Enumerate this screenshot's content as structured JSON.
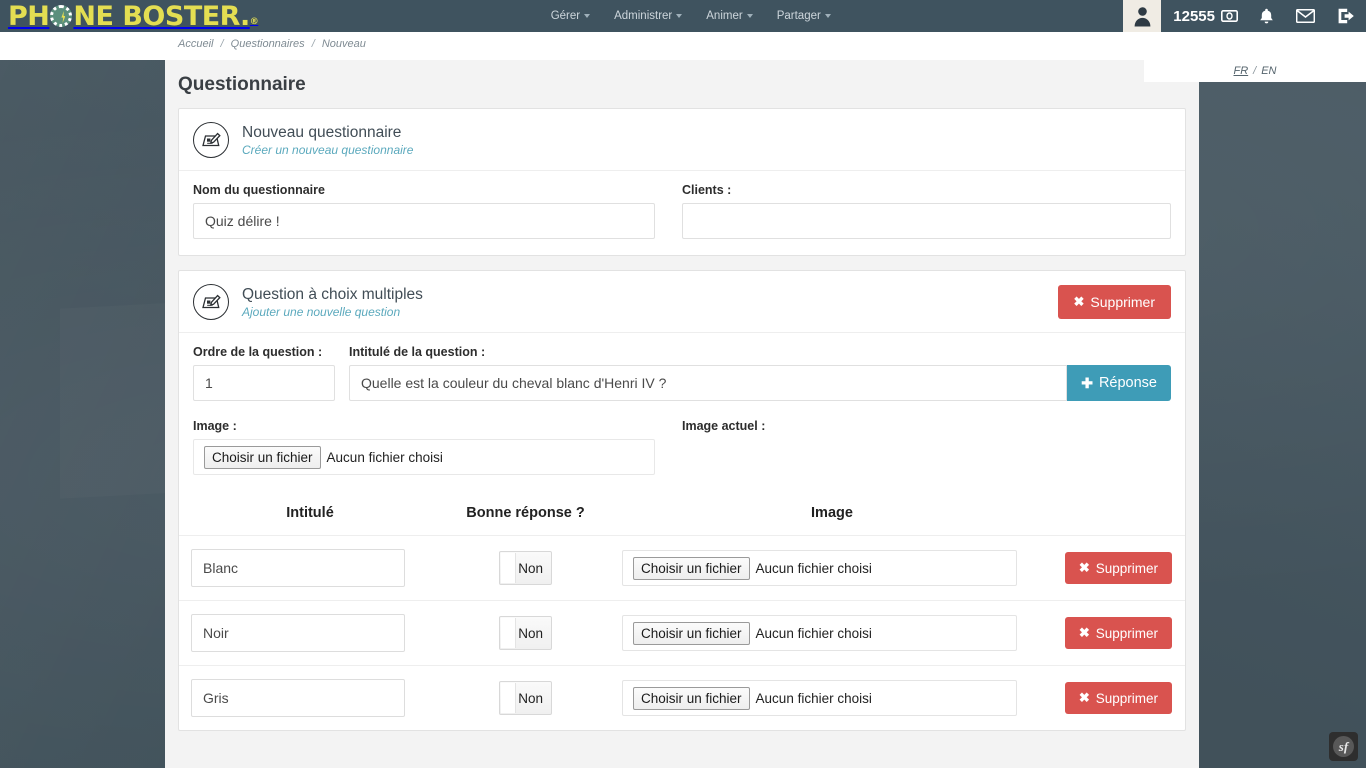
{
  "topbar": {
    "logo": {
      "part1": "PH",
      "o_icon": "phone-circle-icon",
      "part2": "NE B",
      "o2_icon": "letter-o",
      "part3": "OSTER",
      "dot": ".",
      "reg": "®"
    },
    "nav": [
      {
        "label": "Gérer",
        "icon": "chevron-down-icon"
      },
      {
        "label": "Administrer",
        "icon": "chevron-down-icon"
      },
      {
        "label": "Animer",
        "icon": "chevron-down-icon"
      },
      {
        "label": "Partager",
        "icon": "chevron-down-icon"
      }
    ],
    "avatar_icon": "user-avatar-icon",
    "credits": "12555",
    "credits_icon": "money-bill-icon",
    "bell_icon": "bell-icon",
    "mail_icon": "envelope-icon",
    "logout_icon": "logout-icon"
  },
  "breadcrumb": {
    "items": [
      "Accueil",
      "Questionnaires",
      "Nouveau"
    ],
    "separator": "/"
  },
  "language": {
    "fr": "FR",
    "separator": "/",
    "en": "EN",
    "active": "FR"
  },
  "page": {
    "title": "Questionnaire"
  },
  "questionnaire_card": {
    "icon": "edit-form-icon",
    "title": "Nouveau questionnaire",
    "subtitle": "Créer un nouveau questionnaire",
    "fields": {
      "name_label": "Nom du questionnaire",
      "name_value": "Quiz délire !",
      "clients_label": "Clients :",
      "clients_value": ""
    }
  },
  "question_card": {
    "icon": "edit-form-icon",
    "title": "Question à choix multiples",
    "subtitle": "Ajouter une nouvelle question",
    "delete_label": "Supprimer",
    "delete_icon": "times-icon",
    "order_label": "Ordre de la question :",
    "order_value": "1",
    "intitule_label": "Intitulé de la question :",
    "intitule_value": "Quelle est la couleur du cheval blanc d'Henri IV ?",
    "add_answer_label": "Réponse",
    "add_answer_icon": "plus-icon",
    "image_label": "Image :",
    "image_button": "Choisir un fichier",
    "image_filename": "Aucun fichier choisi",
    "image_actuel_label": "Image actuel :",
    "table": {
      "headers": [
        "Intitulé",
        "Bonne réponse ?",
        "Image"
      ],
      "rows": [
        {
          "intitule": "Blanc",
          "bonne_reponse": "Non",
          "file_button": "Choisir un fichier",
          "file_name": "Aucun fichier choisi",
          "delete_label": "Supprimer"
        },
        {
          "intitule": "Noir",
          "bonne_reponse": "Non",
          "file_button": "Choisir un fichier",
          "file_name": "Aucun fichier choisi",
          "delete_label": "Supprimer"
        },
        {
          "intitule": "Gris",
          "bonne_reponse": "Non",
          "file_button": "Choisir un fichier",
          "file_name": "Aucun fichier choisi",
          "delete_label": "Supprimer"
        }
      ]
    }
  },
  "debug_toolbar": {
    "label": "sf"
  },
  "colors": {
    "topbar": "#3f535f",
    "backdrop": "#44555f",
    "logo_yellow": "#e4de52",
    "danger": "#d9534f",
    "teal": "#3e9cb7",
    "subtitle_teal": "#5ba9bd"
  }
}
